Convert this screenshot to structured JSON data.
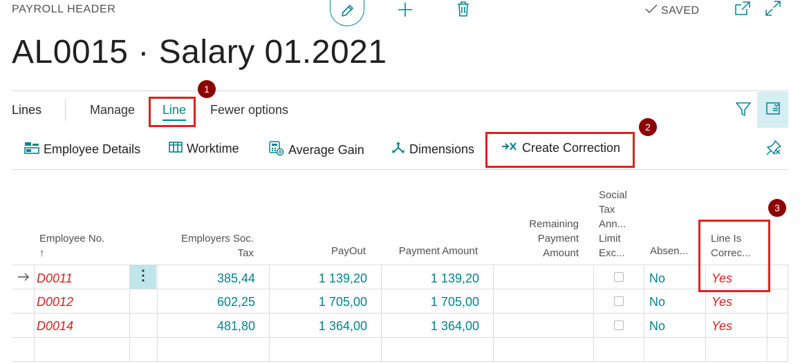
{
  "header": {
    "page_type": "PAYROLL HEADER",
    "title": "AL0015 · Salary 01.2021",
    "status": "SAVED"
  },
  "tabs": {
    "lines": "Lines",
    "manage": "Manage",
    "line": "Line",
    "fewer": "Fewer options"
  },
  "actions": {
    "employee_details": "Employee Details",
    "worktime": "Worktime",
    "average_gain": "Average Gain",
    "dimensions": "Dimensions",
    "create_correction": "Create Correction"
  },
  "callouts": [
    "1",
    "2",
    "3"
  ],
  "table": {
    "columns": {
      "employee_no": "Employee No.",
      "sort_arrow": "↑",
      "emp_soc_tax": [
        "Employers Soc.",
        "Tax"
      ],
      "payout": "PayOut",
      "payment_amount": "Payment Amount",
      "remaining": [
        "Remaining",
        "Payment",
        "Amount"
      ],
      "social_tax": [
        "Social",
        "Tax",
        "Ann...",
        "Limit",
        "Exc..."
      ],
      "absence": "Absen...",
      "line_is_correction": [
        "Line Is",
        "Correc..."
      ]
    },
    "rows": [
      {
        "employee_no": "D0011",
        "emp_soc_tax": "385,44",
        "payout": "1 139,20",
        "payment_amount": "1 139,20",
        "absence": "No",
        "line_is_correction": "Yes"
      },
      {
        "employee_no": "D0012",
        "emp_soc_tax": "602,25",
        "payout": "1 705,00",
        "payment_amount": "1 705,00",
        "absence": "No",
        "line_is_correction": "Yes"
      },
      {
        "employee_no": "D0014",
        "emp_soc_tax": "481,80",
        "payout": "1 364,00",
        "payment_amount": "1 364,00",
        "absence": "No",
        "line_is_correction": "Yes"
      }
    ]
  },
  "colors": {
    "accent": "#00838f",
    "highlight": "#e0201e",
    "badge": "#8b0000",
    "emp_text": "#d81e1e"
  }
}
